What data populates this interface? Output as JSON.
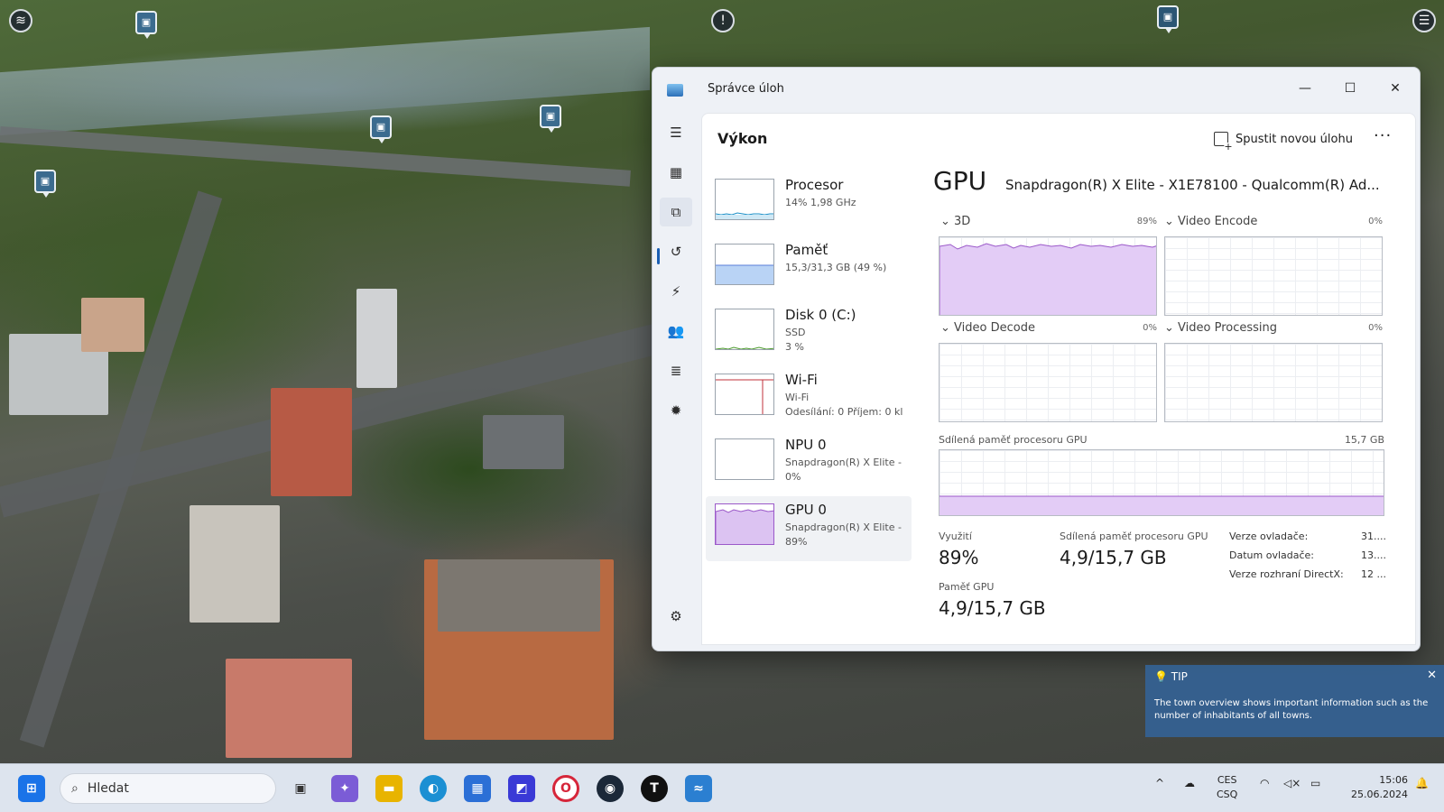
{
  "window": {
    "title": "Správce úloh",
    "controls": {
      "minimize": "—",
      "maximize": "☐",
      "close": "✕"
    }
  },
  "rail": {
    "items": [
      {
        "name": "menu-icon",
        "glyph": "☰"
      },
      {
        "name": "processes-icon",
        "glyph": "▦"
      },
      {
        "name": "performance-icon",
        "glyph": "⧉"
      },
      {
        "name": "history-icon",
        "glyph": "↺"
      },
      {
        "name": "startup-icon",
        "glyph": "⚡"
      },
      {
        "name": "users-icon",
        "glyph": "👥"
      },
      {
        "name": "details-icon",
        "glyph": "≣"
      },
      {
        "name": "services-icon",
        "glyph": "✹"
      }
    ],
    "settings_glyph": "⚙"
  },
  "page": {
    "title": "Výkon",
    "run_task": "Spustit novou úlohu",
    "more": "···"
  },
  "devices": [
    {
      "name": "Procesor",
      "sub1": "14%  1,98 GHz",
      "sub2": "",
      "color": "#1a8fc7"
    },
    {
      "name": "Paměť",
      "sub1": "15,3/31,3 GB (49 %)",
      "sub2": "",
      "color": "#5a7fd9"
    },
    {
      "name": "Disk 0 (C:)",
      "sub1": "SSD",
      "sub2": "3 %",
      "color": "#4a9a2a"
    },
    {
      "name": "Wi-Fi",
      "sub1": "Wi-Fi",
      "sub2": "Odesílání: 0  Příjem: 0 kl",
      "color": "#c1313b"
    },
    {
      "name": "NPU 0",
      "sub1": "Snapdragon(R) X Elite -",
      "sub2": "0%",
      "color": "#9a9a9a"
    },
    {
      "name": "GPU 0",
      "sub1": "Snapdragon(R) X Elite -",
      "sub2": "89%",
      "color": "#9b59c9"
    }
  ],
  "gpu": {
    "heading": "GPU",
    "model": "Snapdragon(R) X Elite - X1E78100 - Qualcomm(R) Ad...",
    "engines": [
      {
        "label": "3D",
        "pct": "89%"
      },
      {
        "label": "Video Encode",
        "pct": "0%"
      },
      {
        "label": "Video Decode",
        "pct": "0%"
      },
      {
        "label": "Video Processing",
        "pct": "0%"
      }
    ],
    "shared_label": "Sdílená paměť procesoru GPU",
    "shared_max": "15,7 GB",
    "stats": {
      "util_label": "Využití",
      "util_value": "89%",
      "shared_label": "Sdílená paměť procesoru GPU",
      "shared_value": "4,9/15,7 GB",
      "mem_label": "Paměť GPU",
      "mem_value": "4,9/15,7 GB"
    },
    "driver": [
      {
        "key": "Verze ovladače:",
        "value": "31...."
      },
      {
        "key": "Datum ovladače:",
        "value": "13...."
      },
      {
        "key": "Verze rozhraní DirectX:",
        "value": "12 ..."
      }
    ]
  },
  "tip": {
    "heading": "TIP",
    "body": "The town overview shows important information such as the number of inhabitants of all towns.",
    "close": "✕"
  },
  "taskbar": {
    "search_placeholder": "Hledat",
    "apps": [
      {
        "name": "start-icon",
        "glyph": "⊞",
        "color": "#1a73e8"
      },
      {
        "name": "task-view-icon",
        "glyph": "▣",
        "color": "#333333"
      },
      {
        "name": "copilot-icon",
        "glyph": "✦",
        "color": "#7b5cd6"
      },
      {
        "name": "file-explorer-icon",
        "glyph": "▬",
        "color": "#e8b400"
      },
      {
        "name": "edge-icon",
        "glyph": "◐",
        "color": "#1b8fd3"
      },
      {
        "name": "store-icon",
        "glyph": "▦",
        "color": "#2b6fd6"
      },
      {
        "name": "app-icon",
        "glyph": "◩",
        "color": "#3a3ad6"
      },
      {
        "name": "opera-icon",
        "glyph": "O",
        "color": "#d6263a"
      },
      {
        "name": "steam-icon",
        "glyph": "◉",
        "color": "#1b2838"
      },
      {
        "name": "game-icon",
        "glyph": "T",
        "color": "#111111"
      },
      {
        "name": "task-manager-icon",
        "glyph": "≈",
        "color": "#2b7fd1"
      }
    ],
    "tray": {
      "chevron": "^",
      "cloud": "☁",
      "wifi": "◠",
      "volume": "◁×",
      "battery": "▭",
      "bell": "🔔"
    },
    "lang_top": "CES",
    "lang_bottom": "CSQ",
    "time": "15:06",
    "date": "25.06.2024"
  },
  "hud": {
    "layers": "≋",
    "alert": "!",
    "menu": "☰",
    "marker": "▣"
  }
}
